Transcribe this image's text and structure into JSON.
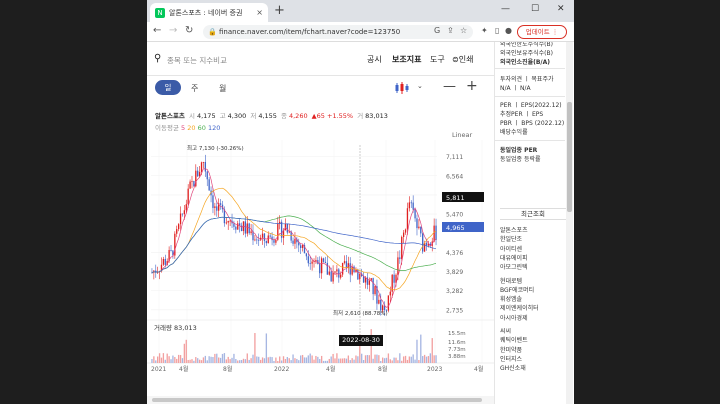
{
  "tab": {
    "title": "알톤스포츠 : 네이버 증권",
    "favicon": "N",
    "close": "×",
    "new_tab": "+"
  },
  "window": {
    "min": "—",
    "max": "☐",
    "close": "✕"
  },
  "address": {
    "url": "finance.naver.com/item/fchart.naver?code=123750"
  },
  "browser": {
    "update_label": "업데이트"
  },
  "toolbar": {
    "search_placeholder": "종목 또는 지수비교",
    "disclosure": "공시",
    "indicators": "보조지표",
    "tools": "도구",
    "print": "인쇄"
  },
  "period": {
    "day": "일",
    "week": "주",
    "month": "월"
  },
  "stock": {
    "name": "알톤스포츠",
    "open_label": "시",
    "open": "4,175",
    "high_label": "고",
    "high": "4,300",
    "low_label": "저",
    "low": "4,155",
    "close_label": "종",
    "close": "4,260",
    "change": "▲65 +1.55%",
    "volume_label": "거",
    "volume": "83,013"
  },
  "ma": {
    "label": "이동평균",
    "periods": [
      "5",
      "20",
      "60",
      "120"
    ],
    "colors": [
      "#e0457b",
      "#f5a623",
      "#4caf50",
      "#3f64c8"
    ]
  },
  "chart_data": {
    "type": "candlestick",
    "scale": "Linear",
    "y_ticks": [
      "7,111",
      "6,564",
      "6,017",
      "5,470",
      "4,376",
      "3,829",
      "3,282",
      "2,735"
    ],
    "current_price_tag": "5,811",
    "last_price_tag": "4,965",
    "high_annotation": "최고 7,130 (-30.26%)",
    "low_annotation": "최저 2,610 (88.78%)",
    "volume_label": "거래량",
    "volume_value": "83,013",
    "volume_ticks": [
      "15.5m",
      "11.6m",
      "7.73m",
      "3.88m"
    ],
    "x_ticks": [
      "2021",
      "4월",
      "8월",
      "2022",
      "4월",
      "8월",
      "2023",
      "4월"
    ],
    "crosshair_date": "2022-08-30"
  },
  "side": {
    "items_top": [
      "외국인한도주식수(B)",
      "외국인보유주식수(B)",
      "외국인소진율(B/A)"
    ],
    "opinion": [
      "투자의견 ㅣ 목표주가",
      "N/A ㅣ N/A"
    ],
    "per": [
      "PER ㅣ EPS(2022.12)",
      "추정PER ㅣ EPS",
      "PBR ㅣ BPS (2022.12)",
      "배당수익률"
    ],
    "sector": [
      "동일업종 PER",
      "동일업종 등락률"
    ],
    "recent_title": "최근조회",
    "recent": [
      "알톤스포츠",
      "한일단조",
      "아이티센",
      "대유에이피",
      "아모그린텍",
      "현대로템",
      "BGF에코머티",
      "휘성엠솔",
      "제이엔케이히터",
      "아시아경제",
      "씨씨",
      "퀘틱이벤트",
      "한미약품",
      "인터지스",
      "GH신소재"
    ]
  }
}
